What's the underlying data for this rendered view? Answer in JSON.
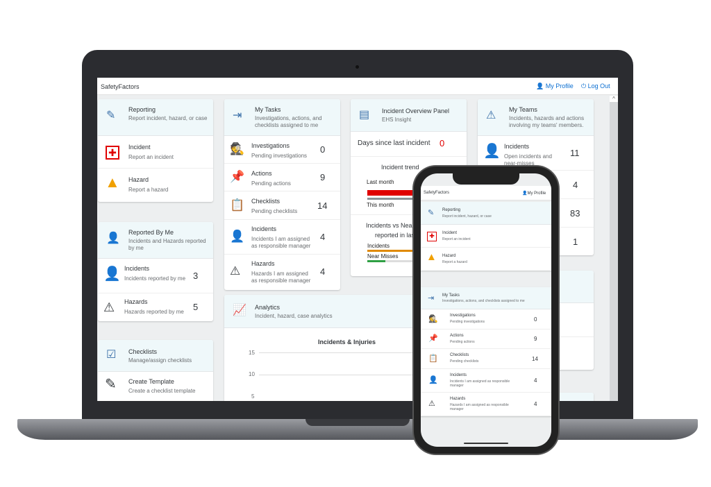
{
  "app": {
    "title": "SafetyFactors",
    "my_profile": "My Profile",
    "log_out": "Log Out"
  },
  "reporting": {
    "title": "Reporting",
    "subtitle": "Report incident, hazard, or case",
    "items": [
      {
        "title": "Incident",
        "subtitle": "Report an incident"
      },
      {
        "title": "Hazard",
        "subtitle": "Report a hazard"
      }
    ]
  },
  "reported_by_me": {
    "title": "Reported By Me",
    "subtitle": "Incidents and Hazards reported by me",
    "items": [
      {
        "title": "Incidents",
        "subtitle": "Incidents reported by me",
        "count": "3"
      },
      {
        "title": "Hazards",
        "subtitle": "Hazards reported by me",
        "count": "5"
      }
    ]
  },
  "checklists": {
    "title": "Checklists",
    "subtitle": "Manage/assign checklists",
    "items": [
      {
        "title": "Create Template",
        "subtitle": "Create a checklist template"
      }
    ]
  },
  "my_tasks": {
    "title": "My Tasks",
    "subtitle": "Investigations, actions, and checklists assigned to me",
    "items": [
      {
        "title": "Investigations",
        "subtitle": "Pending investigations",
        "count": "0"
      },
      {
        "title": "Actions",
        "subtitle": "Pending actions",
        "count": "9"
      },
      {
        "title": "Checklists",
        "subtitle": "Pending checklists",
        "count": "14"
      },
      {
        "title": "Incidents",
        "subtitle": "Incidents I am assigned as responsible manager",
        "count": "4"
      },
      {
        "title": "Hazards",
        "subtitle": "Hazards I am assigned as responsible manager",
        "count": "4"
      }
    ]
  },
  "analytics": {
    "title": "Analytics",
    "subtitle": "Incident, hazard, case analytics",
    "chart_title": "Incidents & Injuries",
    "y_ticks": [
      "15",
      "10",
      "5"
    ]
  },
  "overview": {
    "title": "Incident Overview Panel",
    "subtitle": "EHS Insight",
    "days_label": "Days since last incident",
    "days_value": "0",
    "trend_title": "Incident trend",
    "last_month": "Last month",
    "this_month": "This month",
    "vs_title_1": "Incidents vs Near",
    "vs_title_2": "reported in last 9",
    "incidents_label": "Incidents",
    "near_label": "Near Misses"
  },
  "my_teams": {
    "title": "My Teams",
    "subtitle": "Incidents, hazards and actions involving my teams' members.",
    "items": [
      {
        "title": "Incidents",
        "subtitle": "Open incidents and near-misses",
        "count": "11"
      },
      {
        "count": "4"
      },
      {
        "count": "83"
      },
      {
        "count": "1"
      }
    ]
  },
  "colors": {
    "accent": "#0a6ed1",
    "header_bg": "#eff8fa",
    "incident_red": "#e00000",
    "hazard_orange": "#f0a000",
    "near_miss_green": "#2ea043",
    "incident_bar_orange": "#e08a00"
  }
}
